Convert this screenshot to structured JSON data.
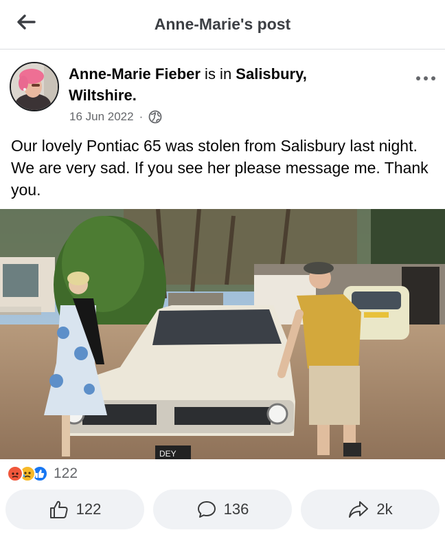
{
  "header": {
    "title": "Anne-Marie's post"
  },
  "post": {
    "author": "Anne-Marie Fieber",
    "connector": " is in ",
    "location": "Salisbury, Wiltshire.",
    "date": "16 Jun 2022",
    "separator": "·",
    "audience_icon": "globe-icon",
    "text": "Our lovely Pontiac 65 was stolen from Salisbury last night. We are very sad. If you see her please message me. Thank you.",
    "photo_plate_text": "DEY",
    "reactions": {
      "icons": [
        "angry-reaction-icon",
        "sad-reaction-icon",
        "like-reaction-icon"
      ],
      "count": "122"
    }
  },
  "actions": {
    "like": {
      "icon": "thumbs-up-icon",
      "count": "122"
    },
    "comment": {
      "icon": "comment-bubble-icon",
      "count": "136"
    },
    "share": {
      "icon": "share-arrow-icon",
      "count": "2k"
    }
  },
  "colors": {
    "secondary_text": "#65676b",
    "action_bg": "#f0f2f5",
    "like_blue": "#1877f2",
    "angry_orange": "#f0573b",
    "sad_yellow": "#f7b928"
  }
}
